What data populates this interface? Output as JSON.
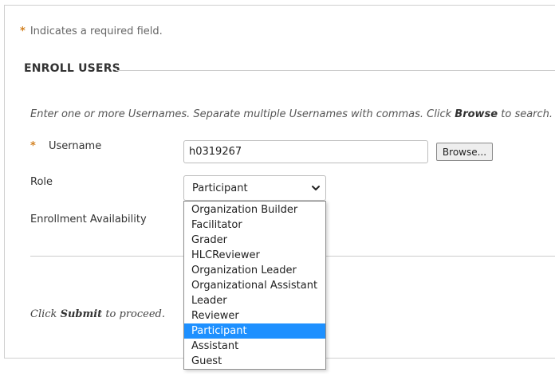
{
  "required_note": {
    "star": "*",
    "text": "Indicates a required field."
  },
  "section": {
    "title": "ENROLL USERS"
  },
  "instructions": {
    "part1": "Enter one or more Usernames. Separate multiple Usernames with commas. Click ",
    "bold": "Browse",
    "part2": " to search."
  },
  "username": {
    "star": "*",
    "label": "Username",
    "value": "h0319267",
    "browse_label": "Browse..."
  },
  "role": {
    "label": "Role",
    "selected": "Participant",
    "options": [
      "Organization Builder",
      "Facilitator",
      "Grader",
      "HLCReviewer",
      "Organization Leader",
      "Organizational Assistant",
      "Leader",
      "Reviewer",
      "Participant",
      "Assistant",
      "Guest"
    ],
    "highlighted_index": 8
  },
  "enrollment_availability": {
    "label": "Enrollment Availability"
  },
  "submit_note": {
    "part1": "Click ",
    "bold": "Submit",
    "part2": " to proceed."
  },
  "colors": {
    "required_star": "#d2801f",
    "highlight": "#1e90ff"
  },
  "icons": {
    "select_arrow": "chevron-down-icon"
  }
}
